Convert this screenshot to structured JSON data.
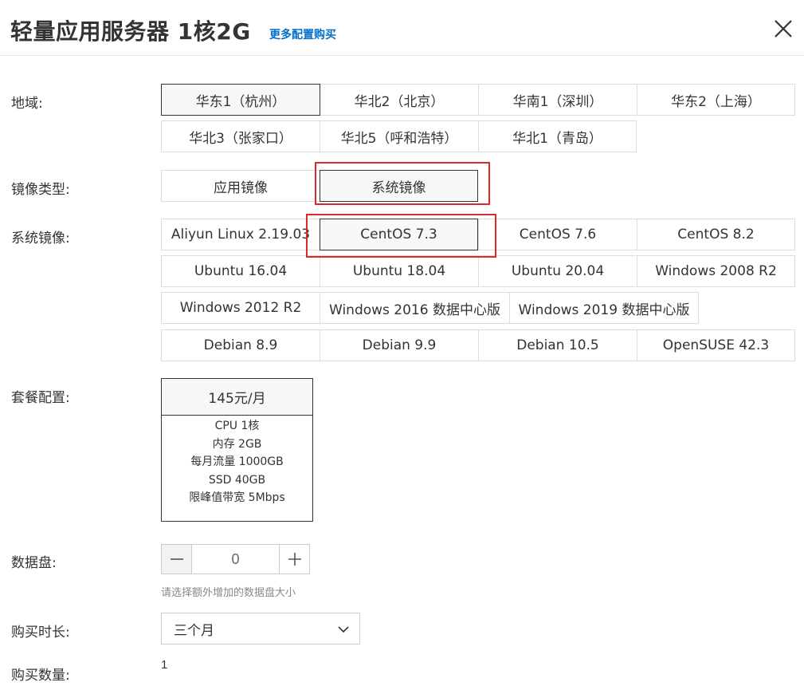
{
  "header": {
    "title": "轻量应用服务器 1核2G",
    "more_link": "更多配置购买"
  },
  "region": {
    "label": "地域:",
    "options": [
      "华东1（杭州）",
      "华北2（北京）",
      "华南1（深圳）",
      "华东2（上海）",
      "华北3（张家口）",
      "华北5（呼和浩特）",
      "华北1（青岛）"
    ],
    "selected": "华东1（杭州）"
  },
  "image_type": {
    "label": "镜像类型:",
    "options": [
      "应用镜像",
      "系统镜像"
    ],
    "selected": "系统镜像"
  },
  "system_image": {
    "label": "系统镜像:",
    "options": [
      "Aliyun Linux 2.19.03",
      "CentOS 7.3",
      "CentOS 7.6",
      "CentOS 8.2",
      "Ubuntu 16.04",
      "Ubuntu 18.04",
      "Ubuntu 20.04",
      "Windows 2008 R2",
      "Windows 2012 R2",
      "Windows 2016 数据中心版",
      "Windows 2019 数据中心版",
      "Debian 8.9",
      "Debian 9.9",
      "Debian 10.5",
      "OpenSUSE 42.3"
    ],
    "selected": "CentOS 7.3"
  },
  "plan": {
    "label": "套餐配置:",
    "price": "145元/月",
    "specs": [
      "CPU 1核",
      "内存 2GB",
      "每月流量 1000GB",
      "SSD 40GB",
      "限峰值带宽 5Mbps"
    ]
  },
  "data_disk": {
    "label": "数据盘:",
    "value": "0",
    "hint": "请选择额外增加的数据盘大小"
  },
  "duration": {
    "label": "购买时长:",
    "value": "三个月"
  },
  "quantity": {
    "label": "购买数量:",
    "value": "1"
  },
  "colors": {
    "link": "#0070cc",
    "highlight_box": "#e0282c",
    "selected_border": "#333333"
  }
}
